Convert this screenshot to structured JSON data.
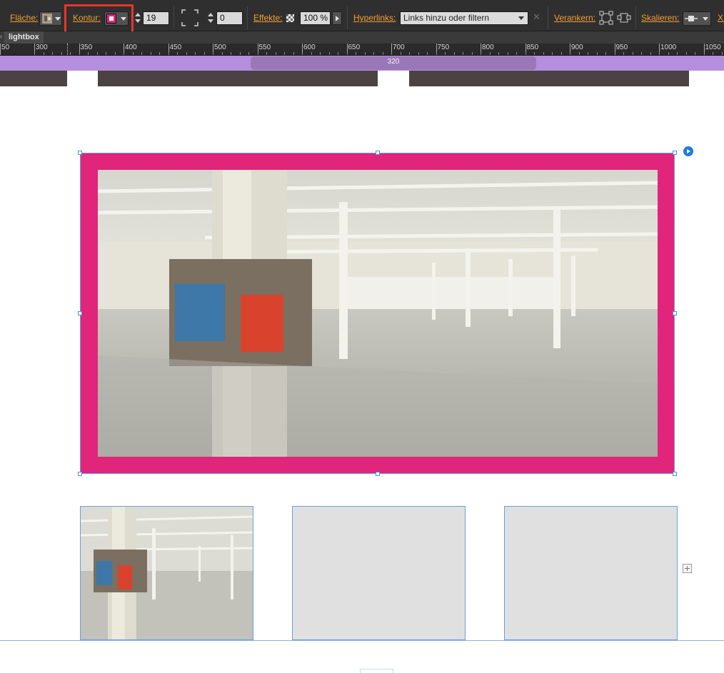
{
  "toolbar": {
    "flaeche_label": "Fläche:",
    "kontur_label": "Kontur:",
    "stroke_width": "19",
    "corner_radius": "0",
    "effekte_label": "Effekte:",
    "opacity": "100 %",
    "hyperlinks_label": "Hyperlinks:",
    "hyperlinks_value": "Links hinzu oder filtern",
    "verankern_label": "Verankern:",
    "skalieren_label": "Skalieren:",
    "x_label": "X:",
    "stroke_color": "#e0257a"
  },
  "document_tab": {
    "title": "lightbox"
  },
  "ruler": {
    "labels": [
      "50",
      "300",
      "350",
      "400",
      "450",
      "500",
      "550",
      "600",
      "650",
      "700",
      "750",
      "800",
      "850",
      "900",
      "950",
      "1000",
      "1050"
    ]
  },
  "breakpoint": {
    "label": "320"
  },
  "colors": {
    "accent_label": "#f4a030",
    "frame_stroke": "#e0257a",
    "selection": "#4a90e2",
    "breakpoint_bar": "#b58fde"
  },
  "icons": {
    "pin": "play-circle-icon",
    "add": "plus-square-icon",
    "close": "close-icon"
  }
}
